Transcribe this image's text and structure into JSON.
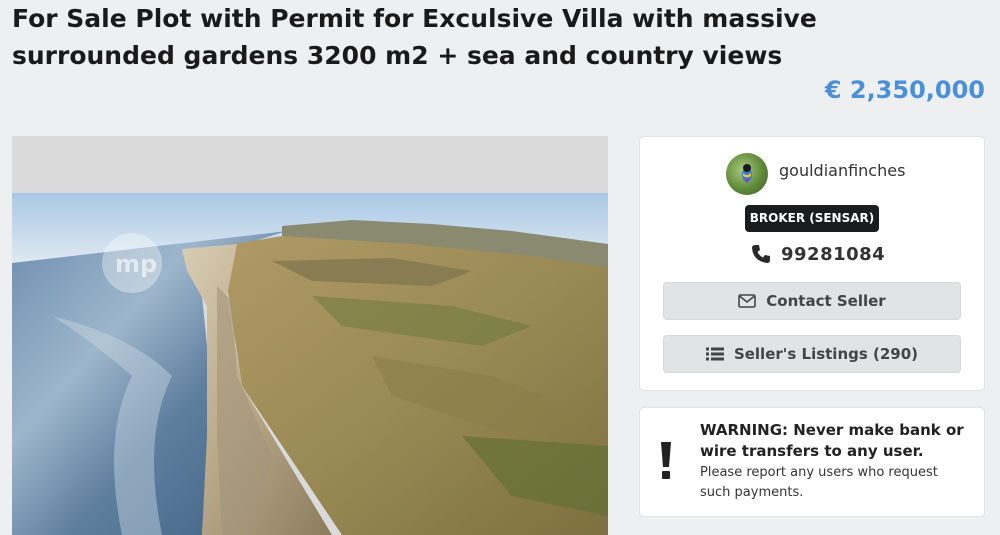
{
  "listing": {
    "title": "For Sale Plot with Permit for Exculsive Villa with massive surrounded gardens 3200 m2 + sea and country views",
    "price": "€ 2,350,000",
    "price_color": "#4a90d9"
  },
  "photo": {
    "watermark_icon": "mp-watermark-logo"
  },
  "seller": {
    "username": "gouldianfinches",
    "badge": "BROKER (SENSAR)",
    "phone": "99281084",
    "contact_label": "Contact Seller",
    "listings_label": "Seller's Listings (290)",
    "icons": {
      "avatar": "bird-avatar",
      "phone": "phone-icon",
      "contact": "envelope-icon",
      "listings": "list-icon"
    }
  },
  "warning": {
    "title": "WARNING: Never make bank or wire transfers to any user.",
    "body": "Please report any users who request such payments.",
    "icon": "exclamation-icon"
  }
}
